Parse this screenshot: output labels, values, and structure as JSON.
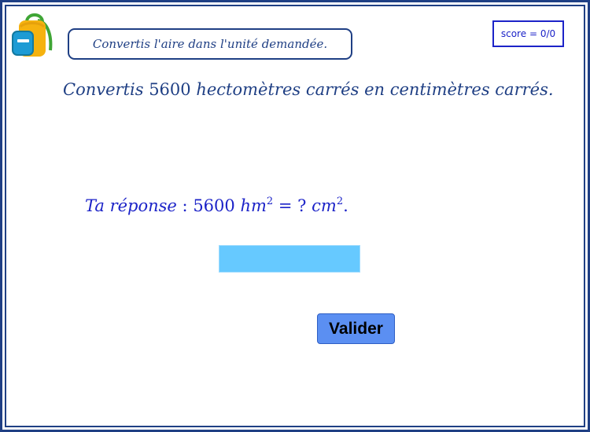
{
  "instruction": "Convertis l'aire dans l'unité demandée.",
  "score": {
    "label": "score",
    "equals": "=",
    "value": "0/0"
  },
  "question": {
    "verb": "Convertis",
    "number": "5600",
    "from_unit": "hectomètres carrés",
    "connector": "en",
    "to_unit": "centimètres carrés."
  },
  "answer": {
    "prefix": "Ta réponse",
    "colon": ":",
    "number": "5600",
    "from_unit": "hm",
    "from_exp": "2",
    "equals": "=",
    "unknown": "?",
    "to_unit": "cm",
    "to_exp": "2",
    "end": ".",
    "input_value": ""
  },
  "validate_label": "Valider",
  "colors": {
    "frame": "#1f3f84",
    "text": "#1f3f84",
    "answer_text": "#1c23c8",
    "input_fill": "#66c9ff",
    "button_fill": "#5b8ff2"
  }
}
